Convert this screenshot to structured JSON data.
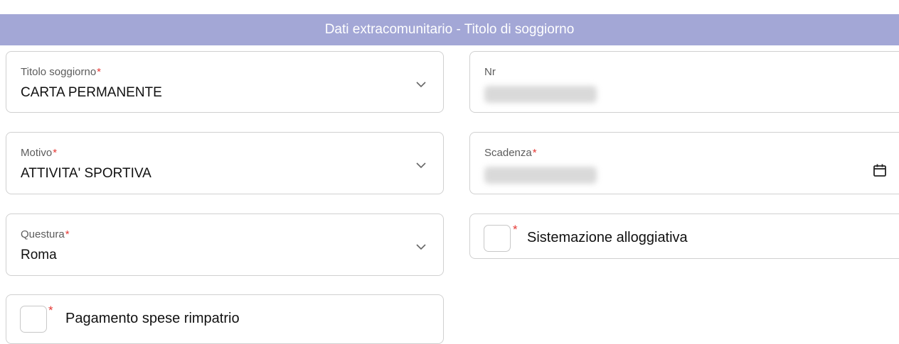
{
  "section": {
    "title": "Dati extracomunitario - Titolo di soggiorno"
  },
  "fields": {
    "titolo_soggiorno": {
      "label": "Titolo soggiorno",
      "required": "*",
      "value": "CARTA PERMANENTE",
      "icon": "chevron-down-icon"
    },
    "nr": {
      "label": "Nr",
      "value_redacted": true
    },
    "motivo": {
      "label": "Motivo",
      "required": "*",
      "value": "ATTIVITA' SPORTIVA",
      "icon": "chevron-down-icon"
    },
    "scadenza": {
      "label": "Scadenza",
      "required": "*",
      "value_redacted": true,
      "icon": "calendar-icon"
    },
    "questura": {
      "label": "Questura",
      "required": "*",
      "value": "Roma",
      "icon": "chevron-down-icon"
    },
    "sistemazione_alloggiativa": {
      "label": "Sistemazione alloggiativa",
      "required": "*",
      "checked": false
    },
    "pagamento_spese_rimpatrio": {
      "label": "Pagamento spese rimpatrio",
      "required": "*",
      "checked": false
    }
  },
  "colors": {
    "header_bg": "#a3a7d6",
    "required": "#e53935",
    "border": "#d0d0d0"
  }
}
